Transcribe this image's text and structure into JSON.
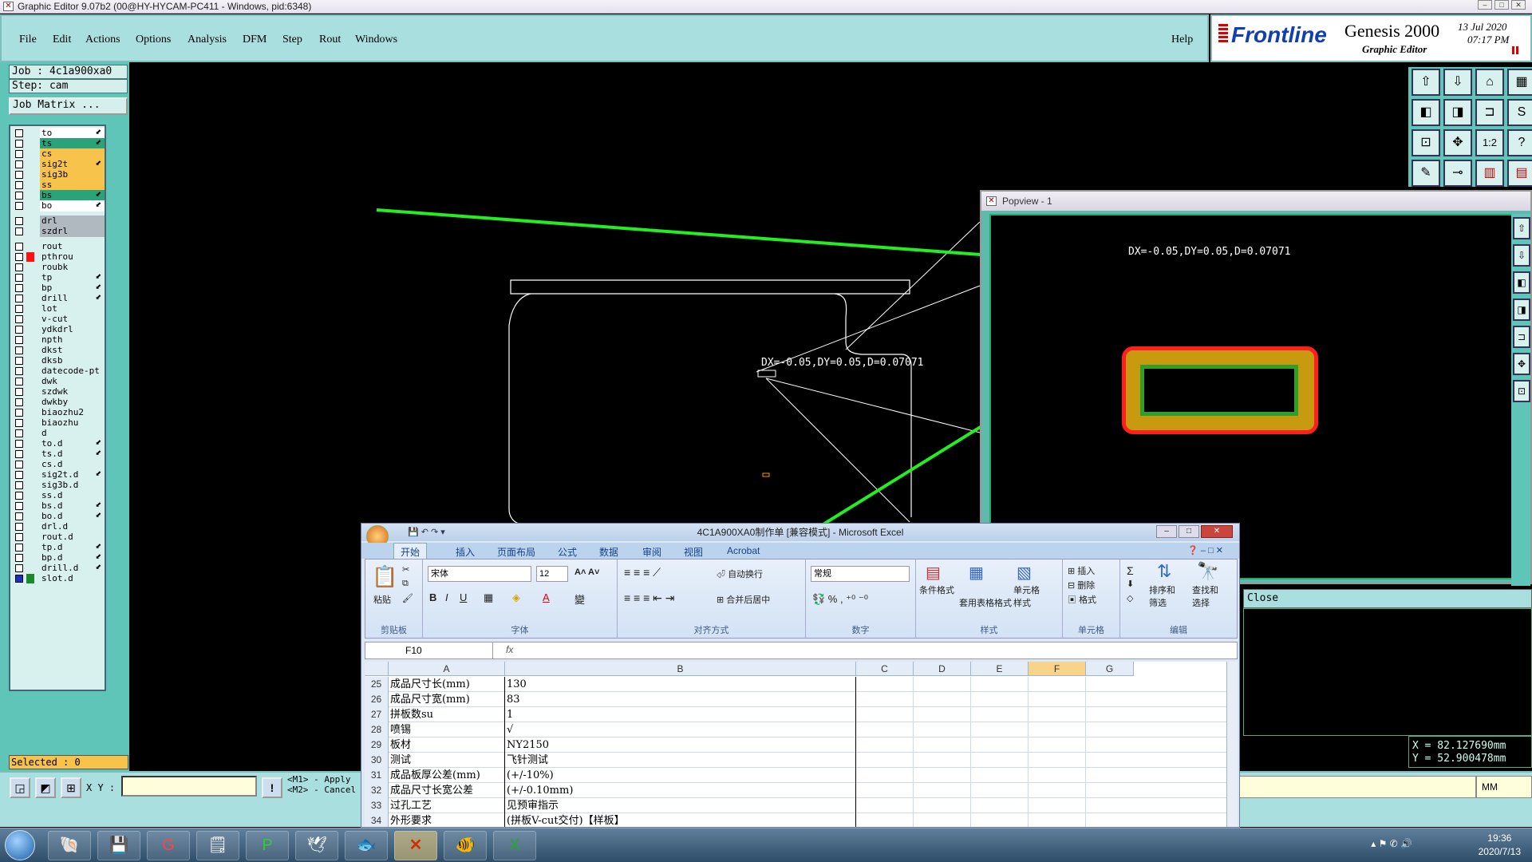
{
  "window": {
    "title": "Graphic Editor 9.07b2 (00@HY-HYCAM-PC411 - Windows, pid:6348)"
  },
  "menu": {
    "items": [
      "File",
      "Edit",
      "Actions",
      "Options",
      "Analysis",
      "DFM",
      "Step",
      "Rout",
      "Windows"
    ],
    "help": "Help"
  },
  "brand": {
    "logo": "Frontline",
    "product": "Genesis 2000",
    "subtitle": "Graphic Editor",
    "date": "13 Jul 2020",
    "time": "07:17 PM"
  },
  "job": {
    "job_label": "Job : 4c1a900xa0",
    "step_label": "Step: cam",
    "matrix_button": "Job Matrix ..."
  },
  "layers": [
    {
      "name": "to",
      "color": "#ffffff",
      "arrow": true
    },
    {
      "name": "ts",
      "color": "#2aa37a",
      "arrow": true
    },
    {
      "name": "cs",
      "color": "#f7c34b",
      "arrow": false
    },
    {
      "name": "sig2t",
      "color": "#f7c34b",
      "arrow": true
    },
    {
      "name": "sig3b",
      "color": "#f7c34b",
      "arrow": false
    },
    {
      "name": "ss",
      "color": "#f7c34b",
      "arrow": false
    },
    {
      "name": "bs",
      "color": "#2aa37a",
      "arrow": true
    },
    {
      "name": "bo",
      "color": "#ffffff",
      "arrow": true
    },
    {
      "name": "drl",
      "color": "#b0b8c0",
      "arrow": false
    },
    {
      "name": "szdrl",
      "color": "#b0b8c0",
      "arrow": false
    },
    {
      "name": "rout",
      "color": "#d9f1ee",
      "arrow": false
    },
    {
      "name": "pthrou",
      "color": "#d9f1ee",
      "arrow": false,
      "swatch": "#ff1111"
    },
    {
      "name": "roubk",
      "color": "#d9f1ee",
      "arrow": false
    },
    {
      "name": "tp",
      "color": "#d9f1ee",
      "arrow": true
    },
    {
      "name": "bp",
      "color": "#d9f1ee",
      "arrow": true
    },
    {
      "name": "drill",
      "color": "#d9f1ee",
      "arrow": true
    },
    {
      "name": "lot",
      "color": "#d9f1ee",
      "arrow": false
    },
    {
      "name": "v-cut",
      "color": "#d9f1ee",
      "arrow": false
    },
    {
      "name": "ydkdrl",
      "color": "#d9f1ee",
      "arrow": false
    },
    {
      "name": "npth",
      "color": "#d9f1ee",
      "arrow": false
    },
    {
      "name": "dkst",
      "color": "#d9f1ee",
      "arrow": false
    },
    {
      "name": "dksb",
      "color": "#d9f1ee",
      "arrow": false
    },
    {
      "name": "datecode-pt",
      "color": "#d9f1ee",
      "arrow": false
    },
    {
      "name": "dwk",
      "color": "#d9f1ee",
      "arrow": false
    },
    {
      "name": "szdwk",
      "color": "#d9f1ee",
      "arrow": false
    },
    {
      "name": "dwkby",
      "color": "#d9f1ee",
      "arrow": false
    },
    {
      "name": "biaozhu2",
      "color": "#d9f1ee",
      "arrow": false
    },
    {
      "name": "biaozhu",
      "color": "#d9f1ee",
      "arrow": false
    },
    {
      "name": "d",
      "color": "#d9f1ee",
      "arrow": false
    },
    {
      "name": "to.d",
      "color": "#d9f1ee",
      "arrow": true
    },
    {
      "name": "ts.d",
      "color": "#d9f1ee",
      "arrow": true
    },
    {
      "name": "cs.d",
      "color": "#d9f1ee",
      "arrow": false
    },
    {
      "name": "sig2t.d",
      "color": "#d9f1ee",
      "arrow": true
    },
    {
      "name": "sig3b.d",
      "color": "#d9f1ee",
      "arrow": false
    },
    {
      "name": "ss.d",
      "color": "#d9f1ee",
      "arrow": false
    },
    {
      "name": "bs.d",
      "color": "#d9f1ee",
      "arrow": true
    },
    {
      "name": "bo.d",
      "color": "#d9f1ee",
      "arrow": true
    },
    {
      "name": "drl.d",
      "color": "#d9f1ee",
      "arrow": false
    },
    {
      "name": "rout.d",
      "color": "#d9f1ee",
      "arrow": false
    },
    {
      "name": "tp.d",
      "color": "#d9f1ee",
      "arrow": true
    },
    {
      "name": "bp.d",
      "color": "#d9f1ee",
      "arrow": true
    },
    {
      "name": "drill.d",
      "color": "#d9f1ee",
      "arrow": true
    },
    {
      "name": "slot.d",
      "color": "#d9f1ee",
      "arrow": false,
      "swatch": "#1a8a2a"
    }
  ],
  "selected": "Selected : 0",
  "canvas": {
    "measure": "DX=-0.05,DY=0.05,D=0.07071"
  },
  "popview": {
    "title": "Popview - 1",
    "measure": "DX=-0.05,DY=0.05,D=0.07071",
    "close": "Close"
  },
  "coords": {
    "x": "X = 82.127690mm",
    "y": "Y = 52.900478mm"
  },
  "bottom": {
    "xy_label": "X Y :",
    "hint1": "<M1> - Apply",
    "hint2": "<M2> - Cancel",
    "units": "MM"
  },
  "excel": {
    "title": "4C1A900XA0制作单 [兼容模式] - Microsoft Excel",
    "tabs": [
      "开始",
      "插入",
      "页面布局",
      "公式",
      "数据",
      "审阅",
      "视图",
      "Acrobat"
    ],
    "groups": [
      "剪贴板",
      "字体",
      "对齐方式",
      "数字",
      "样式",
      "单元格",
      "编辑"
    ],
    "paste": "粘贴",
    "font_name": "宋体",
    "font_size": "12",
    "wrap": "自动换行",
    "merge": "合并后居中",
    "number_format": "常规",
    "cond_format": "条件格式",
    "table_format": "套用表格格式",
    "cell_style": "单元格样式",
    "insert": "插入",
    "delete": "删除",
    "format": "格式",
    "sort": "排序和筛选",
    "find": "查找和选择",
    "namebox": "F10",
    "columns": [
      "A",
      "B",
      "C",
      "D",
      "E",
      "F",
      "G"
    ],
    "rows": [
      {
        "n": "25",
        "a": "成品尺寸长(mm)",
        "b": "130"
      },
      {
        "n": "26",
        "a": "成品尺寸宽(mm)",
        "b": "83"
      },
      {
        "n": "27",
        "a": "拼板数su",
        "b": "1"
      },
      {
        "n": "28",
        "a": "喷锡",
        "b": "√"
      },
      {
        "n": "29",
        "a": "板材",
        "b": "NY2150"
      },
      {
        "n": "30",
        "a": "测试",
        "b": "飞针测试"
      },
      {
        "n": "31",
        "a": "成品板厚公差(mm)",
        "b": "(+/-10%)"
      },
      {
        "n": "32",
        "a": "成品尺寸长宽公差",
        "b": "(+/-0.10mm)"
      },
      {
        "n": "33",
        "a": "过孔工艺",
        "b": "见预审指示"
      },
      {
        "n": "34",
        "a": "外形要求",
        "b": "(拼板V-cut交付)【样板】"
      }
    ]
  },
  "taskbar": {
    "time": "19:36",
    "date": "2020/7/13"
  }
}
